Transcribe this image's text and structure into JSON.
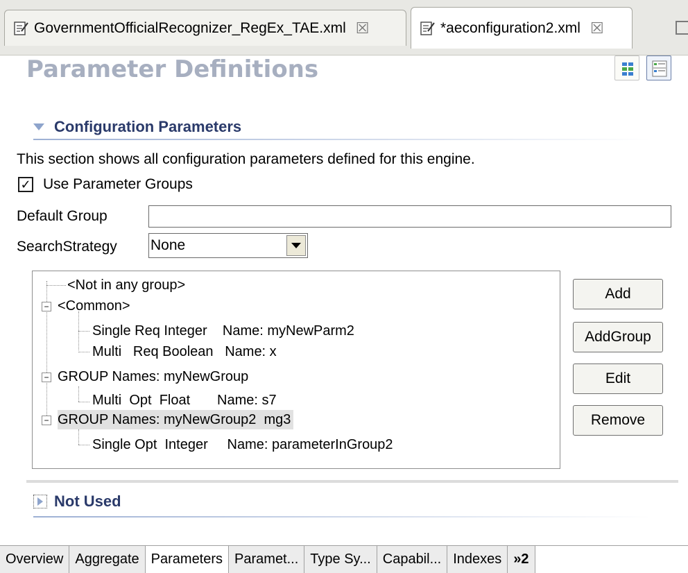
{
  "editor_tabs": [
    {
      "label": "GovernmentOfficialRecognizer_RegEx_TAE.xml",
      "close": "☒"
    },
    {
      "label": "*aeconfiguration2.xml",
      "close": "☒"
    }
  ],
  "form": {
    "title": "Parameter Definitions"
  },
  "config_section": {
    "title": "Configuration Parameters",
    "description": "This section shows all configuration parameters defined for this engine.",
    "use_groups_label": "Use Parameter Groups",
    "use_groups_checked": true,
    "default_group_label": "Default Group",
    "default_group_value": "",
    "search_strategy_label": "SearchStrategy",
    "search_strategy_value": "None"
  },
  "tree": {
    "rows": [
      "<Not in any group>",
      "<Common>",
      "Single Req Integer    Name: myNewParm2",
      "Multi   Req Boolean   Name: x",
      "GROUP Names: myNewGroup",
      "Multi  Opt  Float       Name: s7",
      "GROUP Names: myNewGroup2  mg3",
      "Single Opt  Integer     Name: parameterInGroup2"
    ]
  },
  "buttons": {
    "add": "Add",
    "add_group": "AddGroup",
    "edit": "Edit",
    "remove": "Remove"
  },
  "not_used_section": {
    "title": "Not Used"
  },
  "page_tabs": [
    "Overview",
    "Aggregate",
    "Parameters",
    "Paramet...",
    "Type Sy...",
    "Capabil...",
    "Indexes"
  ],
  "page_tabs_more": "»2",
  "active_page_tab": "Parameters"
}
